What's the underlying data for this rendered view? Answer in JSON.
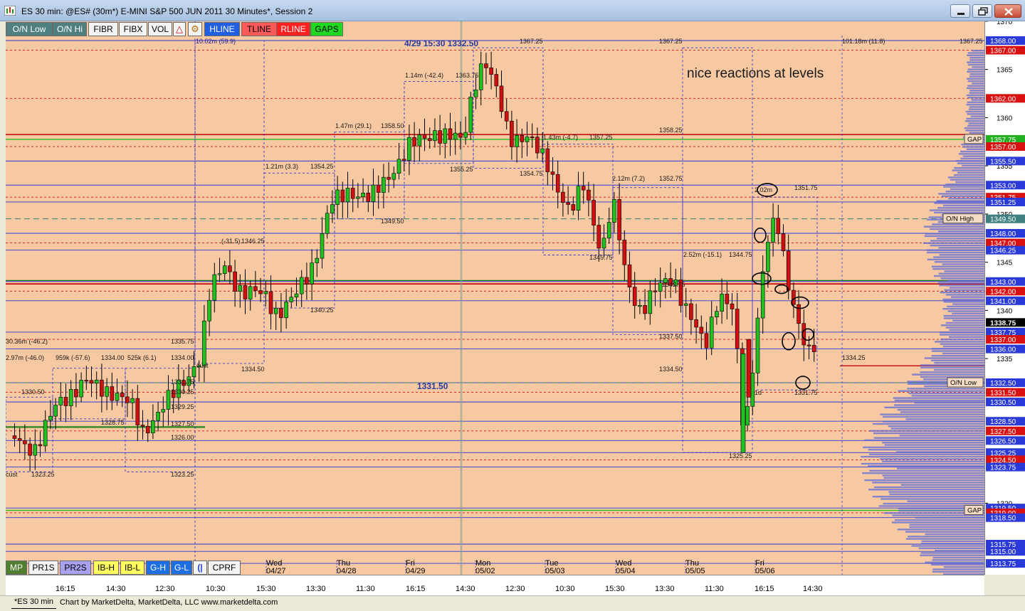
{
  "window": {
    "title": "ES 30 min: @ES# (30m*) E-MINI S&P 500 JUN 2011 30 Minutes*, Session 2"
  },
  "toolbar_top": [
    {
      "label": "O/N Low",
      "bg": "#4f7f7f",
      "fg": "#ffffff"
    },
    {
      "label": "O/N Hi",
      "bg": "#4f7f7f",
      "fg": "#ffffff"
    },
    {
      "label": "FIBR",
      "bg": "#f4f4f4",
      "fg": "#000000"
    },
    {
      "label": "FIBX",
      "bg": "#f4f4f4",
      "fg": "#000000"
    },
    {
      "label": "VOL",
      "bg": "#f4f4f4",
      "fg": "#000000"
    },
    {
      "label": "HLINE",
      "bg": "#1f5fe0",
      "fg": "#ffffff"
    },
    {
      "label": "TLINE",
      "bg": "#ff5a5a",
      "fg": "#000000"
    },
    {
      "label": "RLINE",
      "bg": "#ff2020",
      "fg": "#ffffff"
    },
    {
      "label": "GAPS",
      "bg": "#20d820",
      "fg": "#000000"
    }
  ],
  "toolbar_bottom": [
    {
      "label": "MP",
      "bg": "#4f7f2f",
      "fg": "#ffffff"
    },
    {
      "label": "PR1S",
      "bg": "#f4f4f4",
      "fg": "#000000"
    },
    {
      "label": "PR2S",
      "bg": "#a9a0f0",
      "fg": "#000000"
    },
    {
      "label": "IB-H",
      "bg": "#ffff60",
      "fg": "#000000"
    },
    {
      "label": "IB-L",
      "bg": "#ffff60",
      "fg": "#000000"
    },
    {
      "label": "G-H",
      "bg": "#1f6fe0",
      "fg": "#ffffff"
    },
    {
      "label": "G-L",
      "bg": "#1f6fe0",
      "fg": "#ffffff"
    },
    {
      "label": "CPRF",
      "bg": "#f4f4f4",
      "fg": "#000000"
    }
  ],
  "annotation": "nice reactions at levels",
  "colors": {
    "background": "#f7c9a2",
    "up_candle": "#20c020",
    "down_candle": "#d01010",
    "profile_blue": "#5c6cd8",
    "profile_olive": "#7a7a3a",
    "hline_blue": "#2a3ad8",
    "rline_red": "#d81010"
  },
  "price_axis": {
    "ticks": [
      "1370",
      "1365",
      "1360",
      "1355",
      "1350",
      "1345",
      "1340",
      "1335",
      "1320"
    ],
    "labels": [
      {
        "price": "1368.00",
        "color": "blue"
      },
      {
        "price": "1367.00",
        "color": "red"
      },
      {
        "price": "1362.00",
        "color": "red"
      },
      {
        "price": "1357.75",
        "color": "green"
      },
      {
        "price": "1357.00",
        "color": "red"
      },
      {
        "price": "1355.50",
        "color": "blue"
      },
      {
        "price": "1353.00",
        "color": "blue"
      },
      {
        "price": "1351.75",
        "color": "red"
      },
      {
        "price": "1351.25",
        "color": "blue"
      },
      {
        "price": "1349.50",
        "color": "teal"
      },
      {
        "price": "1348.00",
        "color": "blue"
      },
      {
        "price": "1347.00",
        "color": "red"
      },
      {
        "price": "1346.25",
        "color": "blue"
      },
      {
        "price": "1343.00",
        "color": "blue"
      },
      {
        "price": "1342.00",
        "color": "red"
      },
      {
        "price": "1341.00",
        "color": "blue"
      },
      {
        "price": "1338.75",
        "color": "black"
      },
      {
        "price": "1337.75",
        "color": "blue"
      },
      {
        "price": "1337.00",
        "color": "red"
      },
      {
        "price": "1336.00",
        "color": "blue"
      },
      {
        "price": "1332.50",
        "color": "blue"
      },
      {
        "price": "1331.50",
        "color": "red"
      },
      {
        "price": "1330.50",
        "color": "blue"
      },
      {
        "price": "1328.50",
        "color": "blue"
      },
      {
        "price": "1327.50",
        "color": "red"
      },
      {
        "price": "1326.50",
        "color": "blue"
      },
      {
        "price": "1325.25",
        "color": "blue"
      },
      {
        "price": "1324.50",
        "color": "red"
      },
      {
        "price": "1323.75",
        "color": "blue"
      },
      {
        "price": "1319.50",
        "color": "blue"
      },
      {
        "price": "1319.00",
        "color": "red"
      },
      {
        "price": "1318.50",
        "color": "blue"
      },
      {
        "price": "1315.75",
        "color": "blue"
      },
      {
        "price": "1315.00",
        "color": "blue"
      },
      {
        "price": "1313.75",
        "color": "blue"
      }
    ],
    "tags": [
      {
        "text": "GAP",
        "price": 1357.75
      },
      {
        "text": "O/N High",
        "price": 1349.5
      },
      {
        "text": "O/N Low",
        "price": 1332.5
      },
      {
        "text": "GAP",
        "price": 1319.25
      }
    ]
  },
  "time_axis": {
    "ticks": [
      "16:15",
      "14:30",
      "12:30",
      "10:30",
      "15:30",
      "13:30",
      "11:30",
      "16:15",
      "14:30",
      "12:30",
      "10:30",
      "15:30",
      "13:30",
      "11:30",
      "16:15",
      "14:30"
    ],
    "days": [
      {
        "dow": "Wed",
        "date": "04/27"
      },
      {
        "dow": "Thu",
        "date": "04/28"
      },
      {
        "dow": "Fri",
        "date": "04/29"
      },
      {
        "dow": "Mon",
        "date": "05/02"
      },
      {
        "dow": "Tue",
        "date": "05/03"
      },
      {
        "dow": "Wed",
        "date": "05/04"
      },
      {
        "dow": "Thu",
        "date": "05/05"
      },
      {
        "dow": "Fri",
        "date": "05/06"
      }
    ]
  },
  "chart_labels": [
    {
      "text": "10.02m (59.9)"
    },
    {
      "text": "4/29 15:30  1332.50"
    },
    {
      "text": "1367.25"
    },
    {
      "text": "1367.25"
    },
    {
      "text": "101.18m (11.8)"
    },
    {
      "text": "1367.25"
    },
    {
      "text": "1.14m (-42.4)"
    },
    {
      "text": "1363.75"
    },
    {
      "text": "1.47m (29.1)"
    },
    {
      "text": "1358.50"
    },
    {
      "text": "1358.25"
    },
    {
      "text": "1.43m (-4.7)"
    },
    {
      "text": "1357.25"
    },
    {
      "text": "1355.25"
    },
    {
      "text": "1354.75"
    },
    {
      "text": "1.21m (3.3)"
    },
    {
      "text": "1354.25"
    },
    {
      "text": "2.12m (7.2)"
    },
    {
      "text": "1352.75"
    },
    {
      "text": "1351.75"
    },
    {
      "text": "1349.50"
    },
    {
      "text": "(-31.5)"
    },
    {
      "text": "1346.25"
    },
    {
      "text": "1345.75"
    },
    {
      "text": "2.52m (-15.1)"
    },
    {
      "text": "1344.75"
    },
    {
      "text": "1342.75"
    },
    {
      "text": "1340.25"
    },
    {
      "text": "1337.50"
    },
    {
      "text": "30.36m (-46.2)"
    },
    {
      "text": "1335.75"
    },
    {
      "text": "2.97m (-46.0)"
    },
    {
      "text": "959k (-57.6)"
    },
    {
      "text": "1334.00"
    },
    {
      "text": "525k (6.1)"
    },
    {
      "text": "1334.00"
    },
    {
      "text": "1334.25"
    },
    {
      "text": "cust"
    },
    {
      "text": "1334.50"
    },
    {
      "text": "1334.50"
    },
    {
      "text": "1331.50"
    },
    {
      "text": "1331.75"
    },
    {
      "text": "1331.75"
    },
    {
      "text": "1330.50"
    },
    {
      "text": "1330.25"
    },
    {
      "text": "1329.25"
    },
    {
      "text": "1328.75"
    },
    {
      "text": "1327.50"
    },
    {
      "text": "1326.00"
    },
    {
      "text": "1325.25"
    },
    {
      "text": "cust"
    },
    {
      "text": "1323.25"
    },
    {
      "text": "1323.25"
    },
    {
      "text": "1d"
    },
    {
      "text": "2.02m"
    }
  ],
  "status": {
    "tab": "*ES 30 min",
    "credit": "Chart by MarketDelta, MarketDelta, LLC www.marketdelta.com"
  }
}
